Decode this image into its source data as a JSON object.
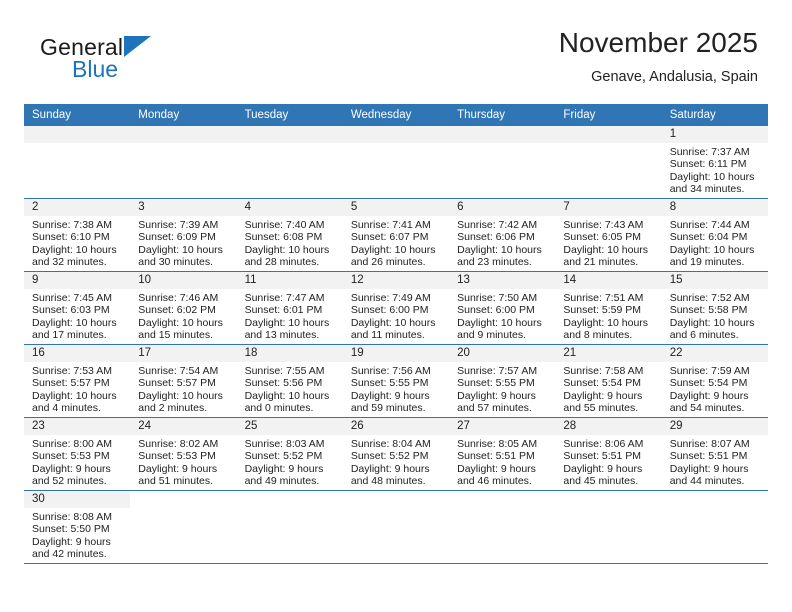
{
  "brand": {
    "name_top": "General",
    "name_bottom": "Blue",
    "accent_color": "#1d74ba"
  },
  "header": {
    "month_title": "November 2025",
    "location": "Genave, Andalusia, Spain",
    "header_bg": "#3075b4"
  },
  "weekday_headers": [
    "Sunday",
    "Monday",
    "Tuesday",
    "Wednesday",
    "Thursday",
    "Friday",
    "Saturday"
  ],
  "labels": {
    "sunrise_prefix": "Sunrise:",
    "sunset_prefix": "Sunset:",
    "daylight_prefix": "Daylight:"
  },
  "weeks": [
    [
      {
        "day": "",
        "blank": true
      },
      {
        "day": "",
        "blank": true
      },
      {
        "day": "",
        "blank": true
      },
      {
        "day": "",
        "blank": true
      },
      {
        "day": "",
        "blank": true
      },
      {
        "day": "",
        "blank": true
      },
      {
        "day": "1",
        "sunrise": "Sunrise: 7:37 AM",
        "sunset": "Sunset: 6:11 PM",
        "daylight_1": "Daylight: 10 hours",
        "daylight_2": "and 34 minutes."
      }
    ],
    [
      {
        "day": "2",
        "sunrise": "Sunrise: 7:38 AM",
        "sunset": "Sunset: 6:10 PM",
        "daylight_1": "Daylight: 10 hours",
        "daylight_2": "and 32 minutes."
      },
      {
        "day": "3",
        "sunrise": "Sunrise: 7:39 AM",
        "sunset": "Sunset: 6:09 PM",
        "daylight_1": "Daylight: 10 hours",
        "daylight_2": "and 30 minutes."
      },
      {
        "day": "4",
        "sunrise": "Sunrise: 7:40 AM",
        "sunset": "Sunset: 6:08 PM",
        "daylight_1": "Daylight: 10 hours",
        "daylight_2": "and 28 minutes."
      },
      {
        "day": "5",
        "sunrise": "Sunrise: 7:41 AM",
        "sunset": "Sunset: 6:07 PM",
        "daylight_1": "Daylight: 10 hours",
        "daylight_2": "and 26 minutes."
      },
      {
        "day": "6",
        "sunrise": "Sunrise: 7:42 AM",
        "sunset": "Sunset: 6:06 PM",
        "daylight_1": "Daylight: 10 hours",
        "daylight_2": "and 23 minutes."
      },
      {
        "day": "7",
        "sunrise": "Sunrise: 7:43 AM",
        "sunset": "Sunset: 6:05 PM",
        "daylight_1": "Daylight: 10 hours",
        "daylight_2": "and 21 minutes."
      },
      {
        "day": "8",
        "sunrise": "Sunrise: 7:44 AM",
        "sunset": "Sunset: 6:04 PM",
        "daylight_1": "Daylight: 10 hours",
        "daylight_2": "and 19 minutes."
      }
    ],
    [
      {
        "day": "9",
        "sunrise": "Sunrise: 7:45 AM",
        "sunset": "Sunset: 6:03 PM",
        "daylight_1": "Daylight: 10 hours",
        "daylight_2": "and 17 minutes."
      },
      {
        "day": "10",
        "sunrise": "Sunrise: 7:46 AM",
        "sunset": "Sunset: 6:02 PM",
        "daylight_1": "Daylight: 10 hours",
        "daylight_2": "and 15 minutes."
      },
      {
        "day": "11",
        "sunrise": "Sunrise: 7:47 AM",
        "sunset": "Sunset: 6:01 PM",
        "daylight_1": "Daylight: 10 hours",
        "daylight_2": "and 13 minutes."
      },
      {
        "day": "12",
        "sunrise": "Sunrise: 7:49 AM",
        "sunset": "Sunset: 6:00 PM",
        "daylight_1": "Daylight: 10 hours",
        "daylight_2": "and 11 minutes."
      },
      {
        "day": "13",
        "sunrise": "Sunrise: 7:50 AM",
        "sunset": "Sunset: 6:00 PM",
        "daylight_1": "Daylight: 10 hours",
        "daylight_2": "and 9 minutes."
      },
      {
        "day": "14",
        "sunrise": "Sunrise: 7:51 AM",
        "sunset": "Sunset: 5:59 PM",
        "daylight_1": "Daylight: 10 hours",
        "daylight_2": "and 8 minutes."
      },
      {
        "day": "15",
        "sunrise": "Sunrise: 7:52 AM",
        "sunset": "Sunset: 5:58 PM",
        "daylight_1": "Daylight: 10 hours",
        "daylight_2": "and 6 minutes."
      }
    ],
    [
      {
        "day": "16",
        "sunrise": "Sunrise: 7:53 AM",
        "sunset": "Sunset: 5:57 PM",
        "daylight_1": "Daylight: 10 hours",
        "daylight_2": "and 4 minutes."
      },
      {
        "day": "17",
        "sunrise": "Sunrise: 7:54 AM",
        "sunset": "Sunset: 5:57 PM",
        "daylight_1": "Daylight: 10 hours",
        "daylight_2": "and 2 minutes."
      },
      {
        "day": "18",
        "sunrise": "Sunrise: 7:55 AM",
        "sunset": "Sunset: 5:56 PM",
        "daylight_1": "Daylight: 10 hours",
        "daylight_2": "and 0 minutes."
      },
      {
        "day": "19",
        "sunrise": "Sunrise: 7:56 AM",
        "sunset": "Sunset: 5:55 PM",
        "daylight_1": "Daylight: 9 hours",
        "daylight_2": "and 59 minutes."
      },
      {
        "day": "20",
        "sunrise": "Sunrise: 7:57 AM",
        "sunset": "Sunset: 5:55 PM",
        "daylight_1": "Daylight: 9 hours",
        "daylight_2": "and 57 minutes."
      },
      {
        "day": "21",
        "sunrise": "Sunrise: 7:58 AM",
        "sunset": "Sunset: 5:54 PM",
        "daylight_1": "Daylight: 9 hours",
        "daylight_2": "and 55 minutes."
      },
      {
        "day": "22",
        "sunrise": "Sunrise: 7:59 AM",
        "sunset": "Sunset: 5:54 PM",
        "daylight_1": "Daylight: 9 hours",
        "daylight_2": "and 54 minutes."
      }
    ],
    [
      {
        "day": "23",
        "sunrise": "Sunrise: 8:00 AM",
        "sunset": "Sunset: 5:53 PM",
        "daylight_1": "Daylight: 9 hours",
        "daylight_2": "and 52 minutes."
      },
      {
        "day": "24",
        "sunrise": "Sunrise: 8:02 AM",
        "sunset": "Sunset: 5:53 PM",
        "daylight_1": "Daylight: 9 hours",
        "daylight_2": "and 51 minutes."
      },
      {
        "day": "25",
        "sunrise": "Sunrise: 8:03 AM",
        "sunset": "Sunset: 5:52 PM",
        "daylight_1": "Daylight: 9 hours",
        "daylight_2": "and 49 minutes."
      },
      {
        "day": "26",
        "sunrise": "Sunrise: 8:04 AM",
        "sunset": "Sunset: 5:52 PM",
        "daylight_1": "Daylight: 9 hours",
        "daylight_2": "and 48 minutes."
      },
      {
        "day": "27",
        "sunrise": "Sunrise: 8:05 AM",
        "sunset": "Sunset: 5:51 PM",
        "daylight_1": "Daylight: 9 hours",
        "daylight_2": "and 46 minutes."
      },
      {
        "day": "28",
        "sunrise": "Sunrise: 8:06 AM",
        "sunset": "Sunset: 5:51 PM",
        "daylight_1": "Daylight: 9 hours",
        "daylight_2": "and 45 minutes."
      },
      {
        "day": "29",
        "sunrise": "Sunrise: 8:07 AM",
        "sunset": "Sunset: 5:51 PM",
        "daylight_1": "Daylight: 9 hours",
        "daylight_2": "and 44 minutes."
      }
    ],
    [
      {
        "day": "30",
        "sunrise": "Sunrise: 8:08 AM",
        "sunset": "Sunset: 5:50 PM",
        "daylight_1": "Daylight: 9 hours",
        "daylight_2": "and 42 minutes."
      },
      {
        "day": "",
        "empty": true
      },
      {
        "day": "",
        "empty": true
      },
      {
        "day": "",
        "empty": true
      },
      {
        "day": "",
        "empty": true
      },
      {
        "day": "",
        "empty": true
      },
      {
        "day": "",
        "empty": true
      }
    ]
  ]
}
